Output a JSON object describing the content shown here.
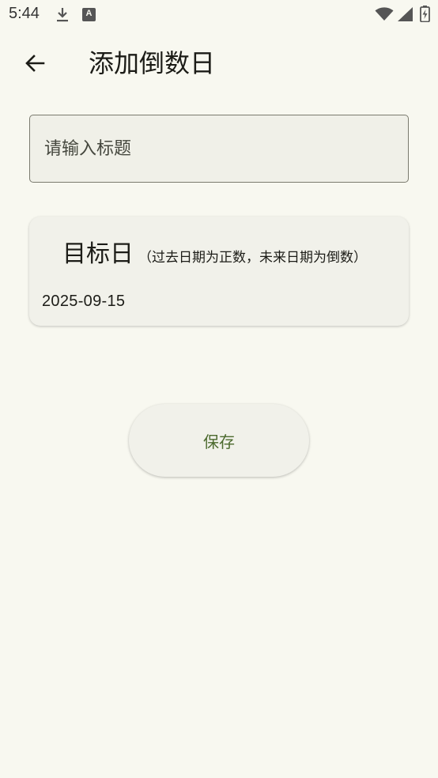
{
  "status_bar": {
    "time": "5:44",
    "icons": [
      "download-icon",
      "text-a-icon",
      "wifi-icon",
      "signal-icon",
      "battery-icon"
    ],
    "a_glyph": "A"
  },
  "app_bar": {
    "back_icon": "arrow-back-icon",
    "title": "添加倒数日"
  },
  "form": {
    "title_input": {
      "placeholder": "请输入标题",
      "value": ""
    },
    "target_date": {
      "label": "目标日",
      "hint": "（过去日期为正数，未来日期为倒数）",
      "value": "2025-09-15"
    },
    "save_label": "保存"
  },
  "colors": {
    "background": "#f8f8f0",
    "surface": "#f1f1ea",
    "accent": "#4c6a2e",
    "text": "#1c1c17"
  }
}
